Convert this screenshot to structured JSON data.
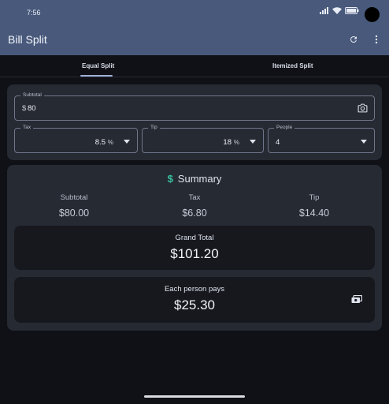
{
  "status": {
    "time": "7:56"
  },
  "app": {
    "title": "Bill Split"
  },
  "tabs": [
    {
      "label": "Equal Split",
      "selected": true
    },
    {
      "label": "Itemized Split",
      "selected": false
    }
  ],
  "inputs": {
    "subtotal": {
      "label": "Subtotal",
      "prefix": "$",
      "value": "80"
    },
    "tax": {
      "label": "Tax",
      "value": "8.5",
      "suffix": "%"
    },
    "tip": {
      "label": "Tip",
      "value": "18",
      "suffix": "%"
    },
    "people": {
      "label": "People",
      "value": "4"
    }
  },
  "summary": {
    "title": "Summary",
    "subtotal_label": "Subtotal",
    "subtotal_value": "$80.00",
    "tax_label": "Tax",
    "tax_value": "$6.80",
    "tip_label": "Tip",
    "tip_value": "$14.40",
    "grand_total_label": "Grand Total",
    "grand_total_value": "$101.20",
    "each_label": "Each person pays",
    "each_value": "$25.30"
  },
  "colors": {
    "appbar": "#48597b",
    "accent": "#38c2a0",
    "background": "#0f1116",
    "card": "#262a33"
  },
  "icons": [
    "wifi-icon",
    "signal-icon",
    "battery-icon",
    "refresh-icon",
    "more-vert-icon",
    "camera-icon",
    "dropdown-icon",
    "dollar-icon",
    "cash-icon"
  ]
}
